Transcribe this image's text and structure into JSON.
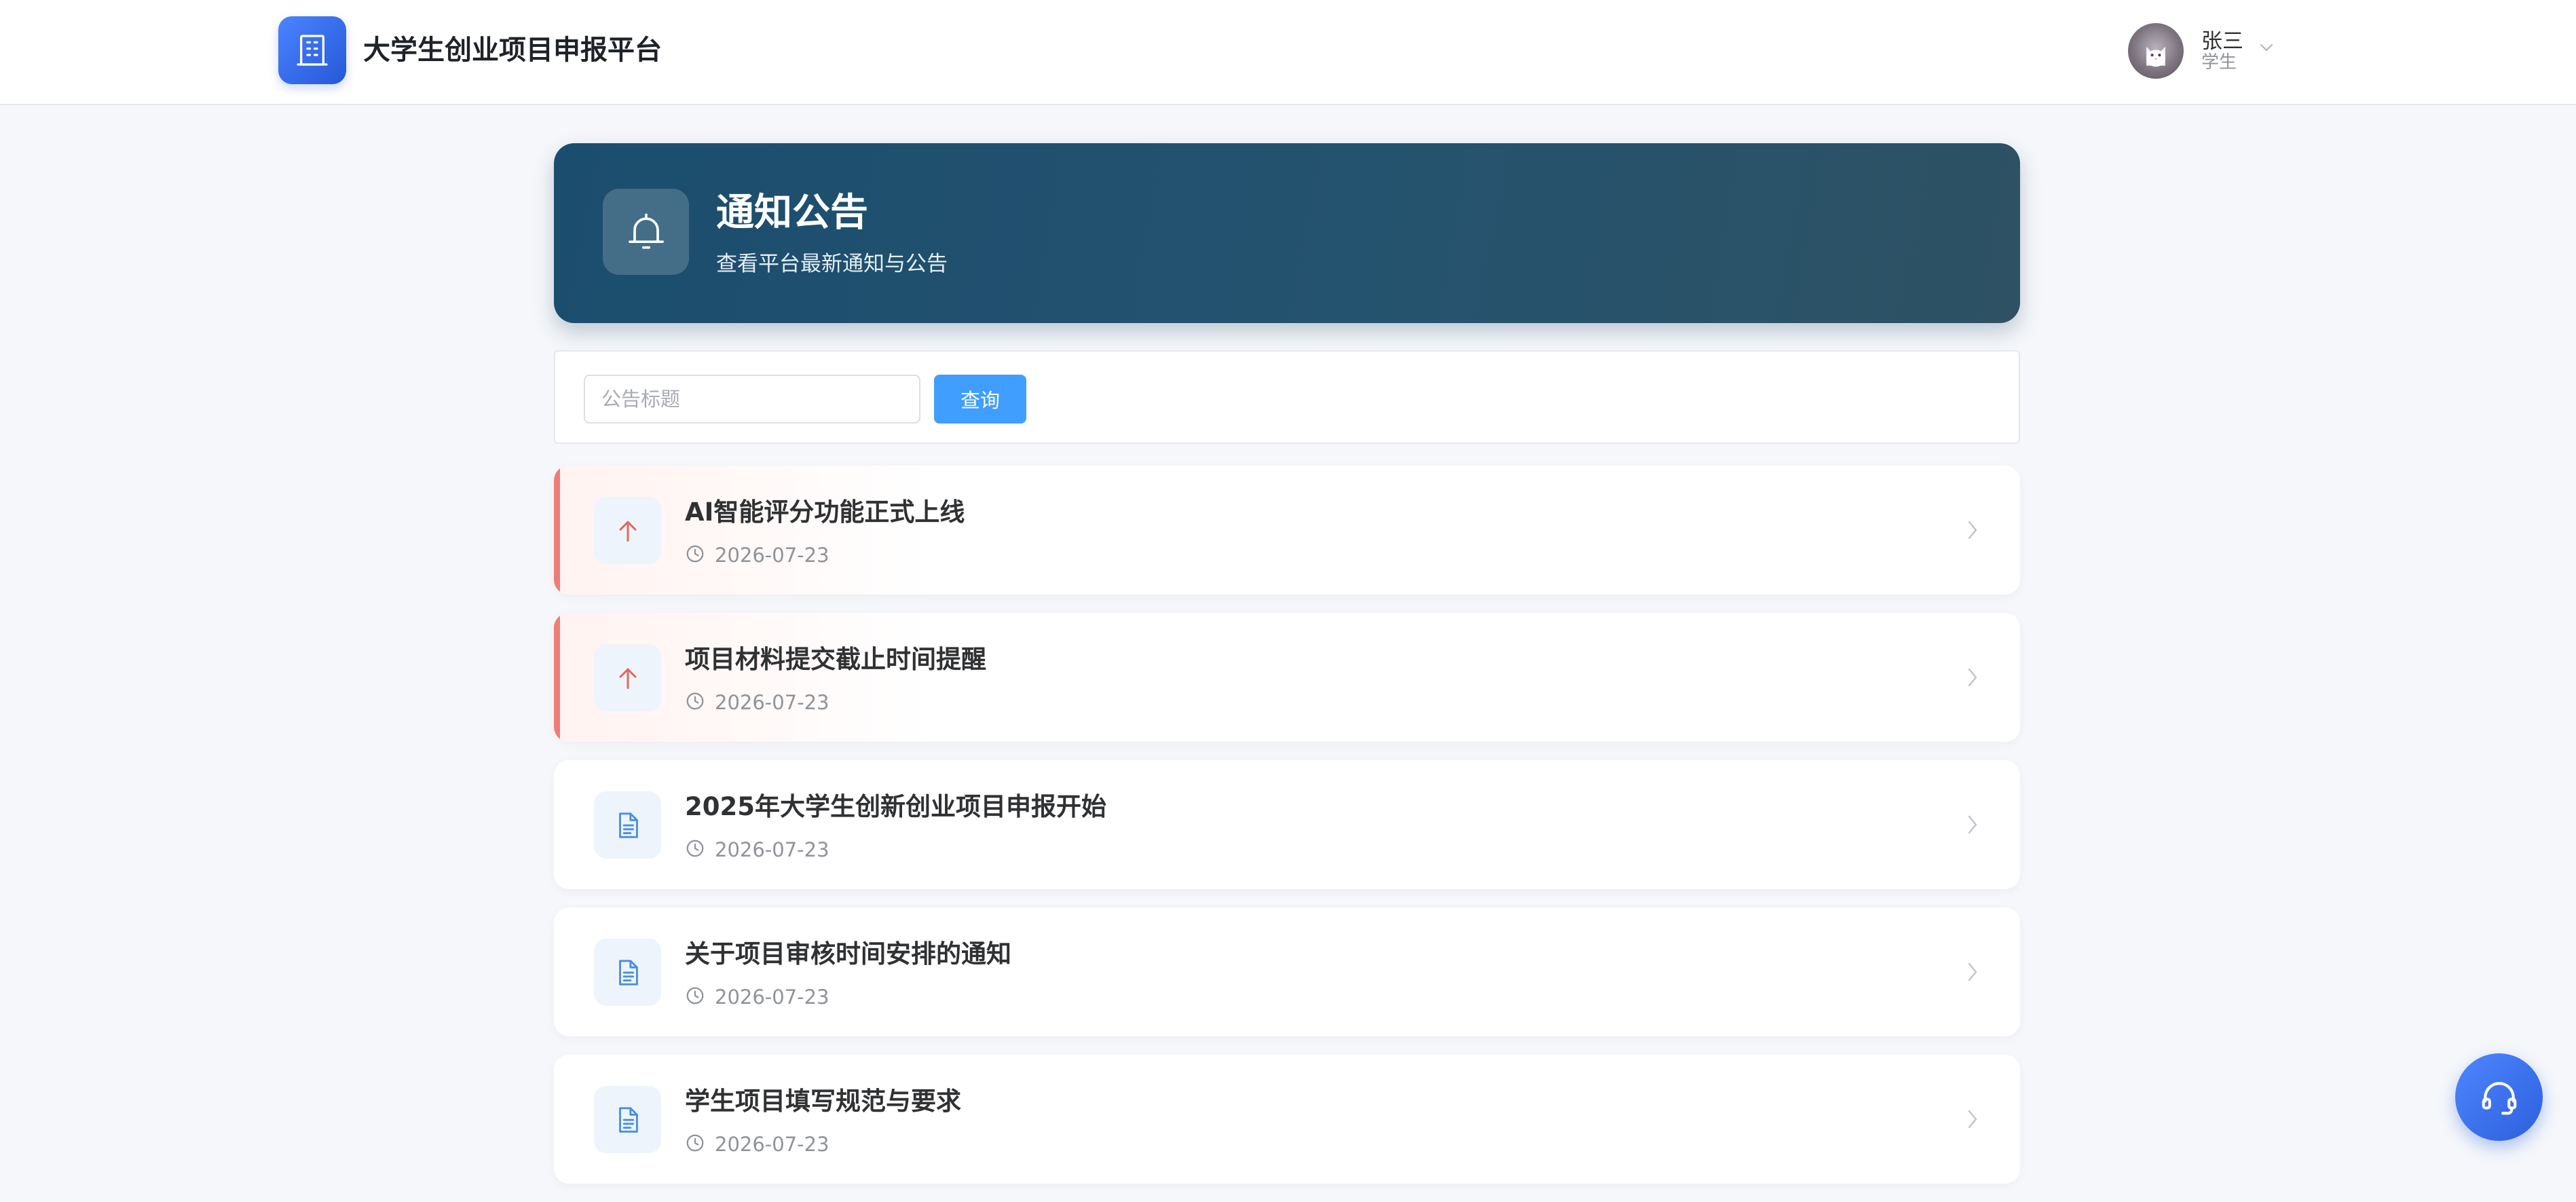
{
  "header": {
    "app_title": "大学生创业项目申报平台",
    "logo_icon": "building-icon",
    "brand_color": "#2f6bff",
    "user": {
      "name": "张三",
      "role": "学生",
      "avatar_icon": "cat-avatar",
      "dropdown_icon": "chevron-down-icon"
    }
  },
  "banner": {
    "title": "通知公告",
    "subtitle": "查看平台最新通知与公告",
    "icon": "bell-icon",
    "color": "#1b4d6e"
  },
  "search": {
    "placeholder": "公告标题",
    "value": "",
    "button_label": "查询",
    "button_color": "#409eff"
  },
  "notices": [
    {
      "title": "AI智能评分功能正式上线",
      "date": "2026-07-23",
      "pinned": true,
      "icon": "arrow-up-icon"
    },
    {
      "title": "项目材料提交截止时间提醒",
      "date": "2026-07-23",
      "pinned": true,
      "icon": "arrow-up-icon"
    },
    {
      "title": "2025年大学生创新创业项目申报开始",
      "date": "2026-07-23",
      "pinned": false,
      "icon": "document-icon"
    },
    {
      "title": "关于项目审核时间安排的通知",
      "date": "2026-07-23",
      "pinned": false,
      "icon": "document-icon"
    },
    {
      "title": "学生项目填写规范与要求",
      "date": "2026-07-23",
      "pinned": false,
      "icon": "document-icon"
    }
  ],
  "pinned_color": "#f07c76",
  "float_service": {
    "icon": "headset-icon"
  }
}
